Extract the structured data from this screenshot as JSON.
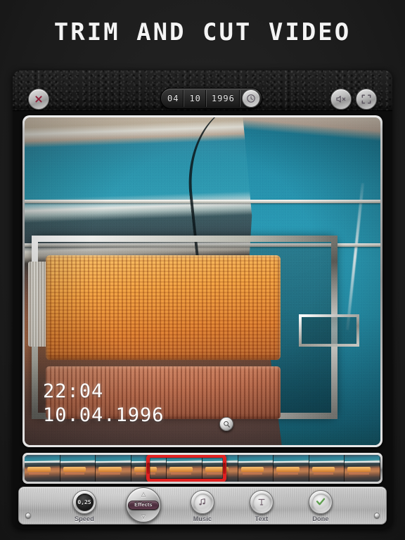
{
  "headline": "TRIM AND CUT VIDEO",
  "topbar": {
    "close_icon": "close-x-icon",
    "mute_icon": "speaker-mute-icon",
    "fullscreen_icon": "fullscreen-expand-icon",
    "date_segments": [
      "04",
      "10",
      "1996"
    ],
    "clock_icon": "clock-icon"
  },
  "video": {
    "overlay_time": "22:04",
    "overlay_date": "10.04.1996",
    "magnifier_icon": "magnifier-icon"
  },
  "timeline": {
    "thumbnail_count": 10,
    "selection_label": "trim-selection"
  },
  "controls": [
    {
      "name": "speed",
      "label": "Speed",
      "value": "0,25",
      "icon": "speed-dial-icon"
    },
    {
      "name": "effects",
      "label": "",
      "value": "Effects",
      "icon": "effects-knob-icon"
    },
    {
      "name": "music",
      "label": "Music",
      "value": "",
      "icon": "music-note-icon"
    },
    {
      "name": "text",
      "label": "Text",
      "value": "",
      "icon": "text-t-icon"
    },
    {
      "name": "done",
      "label": "Done",
      "value": "",
      "icon": "check-icon"
    }
  ],
  "colors": {
    "background": "#1e1e1e",
    "headline": "#f4f4f4",
    "trim_selection": "#e02121",
    "done_check": "#5e9e4e",
    "panel_metal": "#b7b7b7",
    "video_teal": "#2b9cb7",
    "video_amber": "#ef9c3e"
  }
}
